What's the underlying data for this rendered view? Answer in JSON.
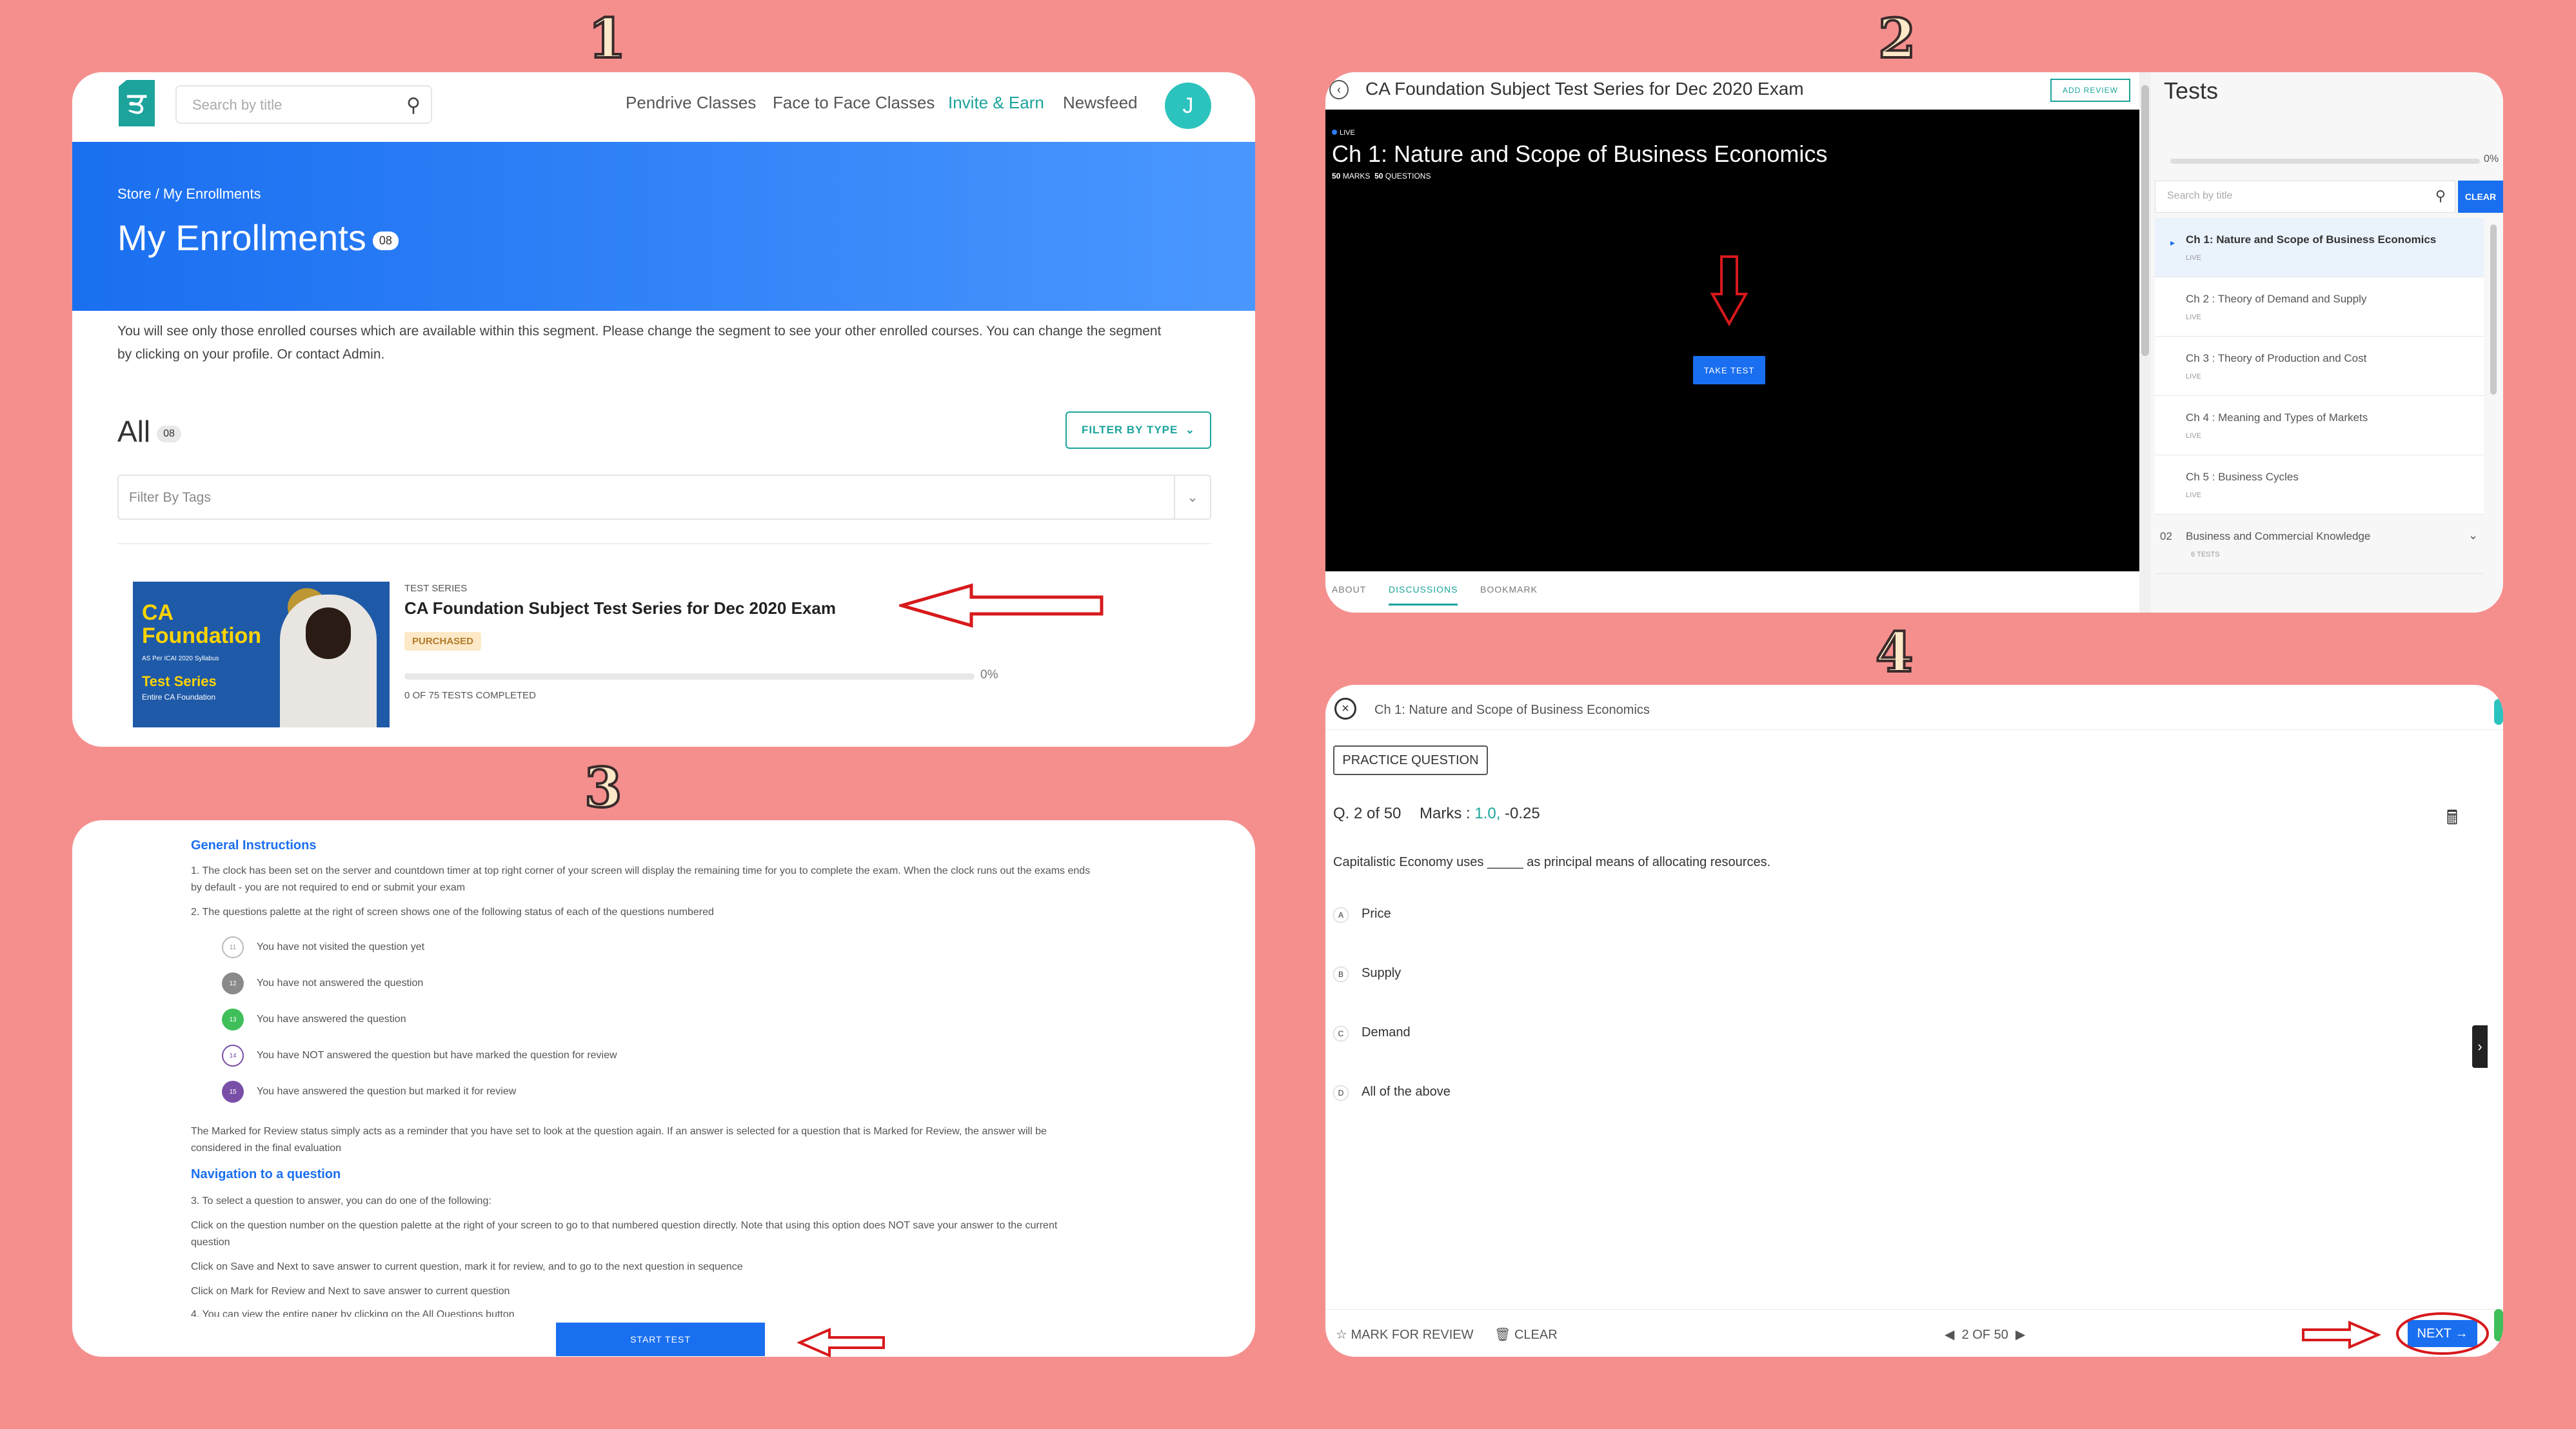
{
  "steps": [
    "1",
    "2",
    "3",
    "4"
  ],
  "p1": {
    "search_placeholder": "Search by title",
    "nav": [
      "Pendrive Classes",
      "Face to Face Classes",
      "Invite & Earn",
      "Newsfeed"
    ],
    "avatar_letter": "J",
    "logo_letter": "ਤ",
    "breadcrumb": "Store / My Enrollments",
    "title": "My Enrollments",
    "count": "08",
    "notice": "You will see only those enrolled courses which are available within this segment. Please change the segment to see your other enrolled courses. You can change the segment by clicking on your profile. Or contact Admin.",
    "all_label": "All",
    "all_count": "08",
    "filter_button": "FILTER BY TYPE",
    "tags_placeholder": "Filter By Tags",
    "card": {
      "thumb_line1": "CA",
      "thumb_line2": "Foundation",
      "thumb_line3": "AS Per ICAI 2020 Syllabus",
      "thumb_line4": "Test Series",
      "thumb_line5": "Entire CA Foundation",
      "tag": "TEST SERIES",
      "title": "CA Foundation Subject Test Series for Dec 2020 Exam",
      "status": "PURCHASED",
      "progress_pct": "0%",
      "progress_value": 0,
      "tests_completed": "0 OF 75 TESTS COMPLETED"
    }
  },
  "p2": {
    "title": "CA Foundation Subject Test Series for Dec 2020 Exam",
    "add_review": "ADD REVIEW",
    "live": "LIVE",
    "chapter_title": "Ch 1: Nature and Scope of Business Economics",
    "marks_count": "50",
    "marks_label": "MARKS",
    "questions_count": "50",
    "questions_label": "QUESTIONS",
    "take_test": "TAKE TEST",
    "tabs": [
      "ABOUT",
      "DISCUSSIONS",
      "BOOKMARK"
    ],
    "sidebar_title": "Tests",
    "sidebar_pct": "0%",
    "sidebar_search": "Search by title",
    "clear": "CLEAR",
    "chapters": [
      {
        "title": "Ch 1: Nature and Scope of Business Economics",
        "status": "LIVE"
      },
      {
        "title": "Ch 2 : Theory of Demand and Supply",
        "status": "LIVE"
      },
      {
        "title": "Ch 3 : Theory of Production and Cost",
        "status": "LIVE"
      },
      {
        "title": "Ch 4 : Meaning and Types of Markets",
        "status": "LIVE"
      },
      {
        "title": "Ch 5 : Business Cycles",
        "status": "LIVE"
      }
    ],
    "section": {
      "num": "02",
      "title": "Business and Commercial Knowledge",
      "sub": "6 TESTS"
    }
  },
  "p3": {
    "general_heading": "General Instructions",
    "line1": "1. The clock has been set on the server and countdown timer at top right corner of your screen will display the remaining time for you to complete the exam. When the clock runs out the exams ends by default - you are not required to end or submit your exam",
    "line2": "2. The questions palette at the right of screen shows one of the following status of each of the questions numbered",
    "legend": [
      {
        "num": "11",
        "text": "You have not visited the question yet"
      },
      {
        "num": "12",
        "text": "You have not answered the question"
      },
      {
        "num": "13",
        "text": "You have answered the question"
      },
      {
        "num": "14",
        "text": "You have NOT answered the question but have marked the question for review"
      },
      {
        "num": "15",
        "text": "You have answered the question but marked it for review"
      }
    ],
    "review_note": "The Marked for Review status simply acts as a reminder that you have set to look at the question again. If an answer is selected for a question that is Marked for Review, the answer will be considered in the final evaluation",
    "nav_heading": "Navigation to a question",
    "nav1": "3. To select a question to answer, you can do one of the following:",
    "nav2": "Click on the question number on the question palette at the right of your screen to go to that numbered question directly. Note that using this option does NOT save your answer to the current question",
    "nav3": "Click on Save and Next to save answer to current question, mark it for review, and to go to the next question in sequence",
    "nav4": "Click on Mark for Review and Next to save answer to current question",
    "nav5": "4. You can view the entire paper by clicking on the All Questions button",
    "start_test": "START TEST"
  },
  "p4": {
    "title": "Ch 1: Nature and Scope of Business Economics",
    "practice": "PRACTICE QUESTION",
    "qnum": "Q. 2 of 50",
    "marks_label": "Marks :",
    "marks_pos": "1.0,",
    "marks_neg": "-0.25",
    "question": "Capitalistic Economy uses _____ as principal means of allocating resources.",
    "options": [
      {
        "letter": "A",
        "text": "Price"
      },
      {
        "letter": "B",
        "text": "Supply"
      },
      {
        "letter": "C",
        "text": "Demand"
      },
      {
        "letter": "D",
        "text": "All of the above"
      }
    ],
    "mark_review": "MARK FOR REVIEW",
    "clear": "CLEAR",
    "pager": "2 OF 50",
    "next": "NEXT"
  },
  "colors": {
    "background": "#f58f8e",
    "primary": "#1a6ff0",
    "teal": "#1ba39c",
    "arrow": "#d7191c"
  }
}
